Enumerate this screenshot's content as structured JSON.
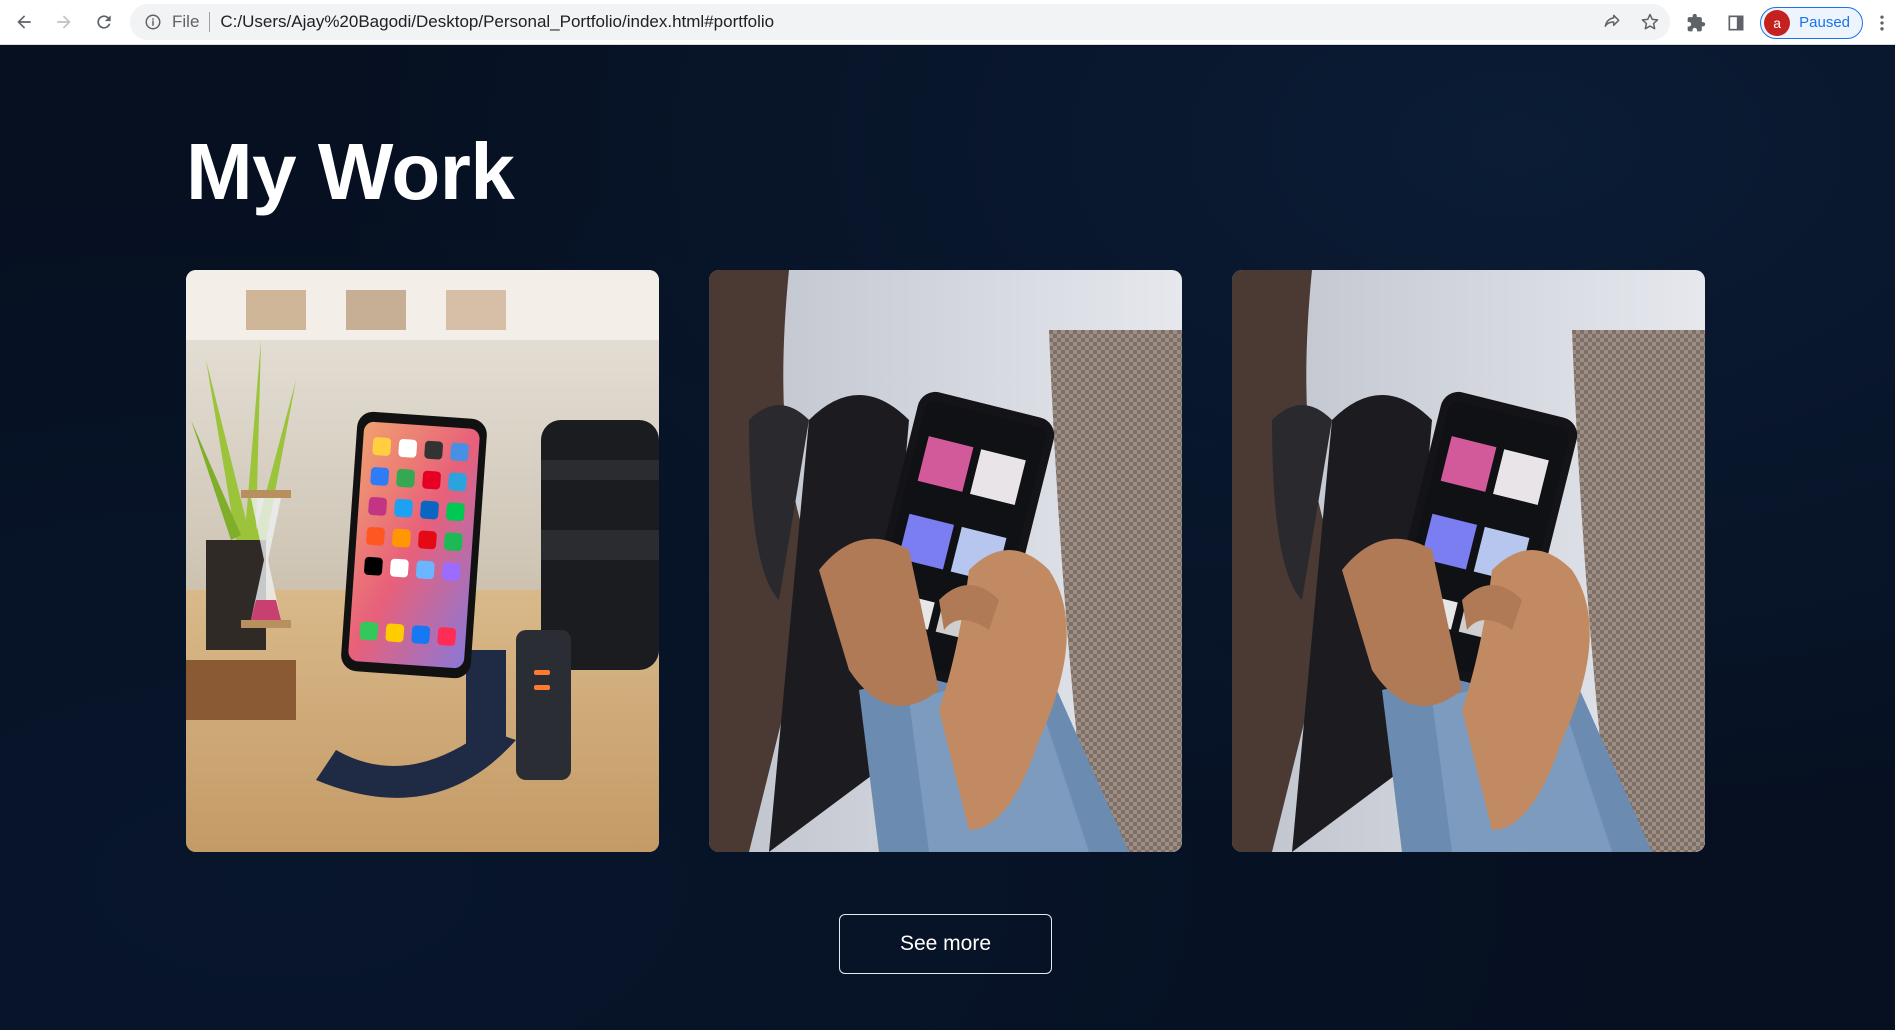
{
  "browser": {
    "scheme_label": "File",
    "url": "C:/Users/Ajay%20Bagodi/Desktop/Personal_Portfolio/index.html#portfolio",
    "profile_initial": "a",
    "profile_status": "Paused",
    "icons": {
      "back": "arrow-left-icon",
      "forward": "arrow-right-icon",
      "reload": "reload-icon",
      "info": "info-icon",
      "share": "share-icon",
      "bookmark": "star-icon",
      "extensions": "puzzle-icon",
      "side_panel": "side-panel-icon",
      "menu": "kebab-menu-icon"
    },
    "accent_color": "#1a73e8",
    "avatar_color": "#c5221f"
  },
  "portfolio": {
    "title": "My Work",
    "works": [
      {
        "subject": "phone on stand with camera lens"
      },
      {
        "subject": "hands holding phone with music app"
      },
      {
        "subject": "hands holding phone with music app"
      }
    ],
    "see_more_label": "See more",
    "background_color": "#061021"
  }
}
